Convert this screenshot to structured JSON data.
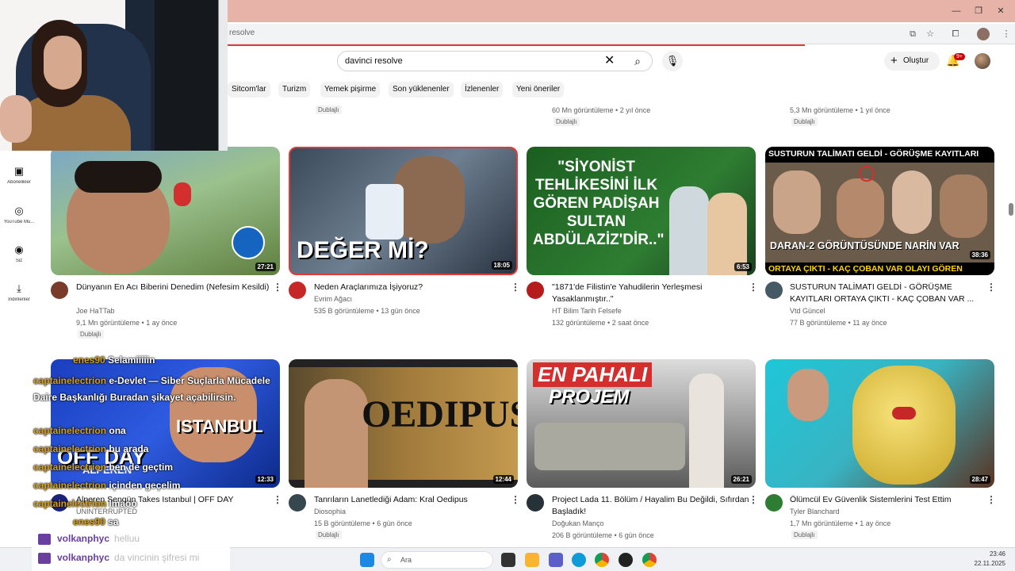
{
  "address": {
    "text": "resolve"
  },
  "search": {
    "query": "davinci resolve"
  },
  "header": {
    "create_label": "Oluştur",
    "notification_badge": "9+"
  },
  "chips": [
    "Sitcom'lar",
    "Turizm",
    "Yemek pişirme",
    "Son yüklenenler",
    "İzlenenler",
    "Yeni öneriler"
  ],
  "top_row": {
    "v1": {
      "dub": "Dublajlı"
    },
    "v2": {
      "meta": "60 Mn görüntüleme • 2 yıl önce",
      "dub": "Dublajlı"
    },
    "v3": {
      "meta": "5,3 Mn görüntüleme • 1 yıl önce",
      "dub": "Dublajlı"
    }
  },
  "sidebar": [
    {
      "label": "Abonelikler",
      "icon": "subscriptions-icon"
    },
    {
      "label": "YouTube Mu...",
      "icon": "youtube-music-icon"
    },
    {
      "label": "Siz",
      "icon": "you-icon"
    },
    {
      "label": "İndirilenler",
      "icon": "downloads-icon"
    }
  ],
  "videos": [
    {
      "thumb_text": "",
      "duration": "27:21",
      "title": "Dünyanın En Acı Biberini Denedim (Nefesim Kesildi)",
      "channel": "Joe HaTTab",
      "meta": "9,1 Mn görüntüleme • 1 ay önce",
      "dub": "Dublajlı",
      "avatar_color": "#7a3b2a"
    },
    {
      "thumb_text": "DEĞER Mİ?",
      "duration": "18:05",
      "title": "Neden Araçlarımıza İşiyoruz?",
      "channel": "Evrim Ağacı",
      "meta": "535 B görüntüleme • 13 gün önce",
      "dub": "",
      "avatar_color": "#c62828"
    },
    {
      "thumb_text": "\"SİYONİST TEHLİKESİNİ İLK GÖREN PADİŞAH SULTAN ABDÜLAZİZ'DİR..\"",
      "duration": "6:53",
      "title": "\"1871'de Filistin'e Yahudilerin Yerleşmesi Yasaklanmıştır..\"",
      "channel": "HT Bilim Tarih Felsefe",
      "meta": "132 görüntüleme • 2 saat önce",
      "dub": "",
      "avatar_color": "#b71c1c"
    },
    {
      "thumb_text": "SUSTURUN TALİMATI GELDİ - GÖRÜŞME KAYITLARI",
      "thumb_text2": "DARAN-2 GÖRÜNTÜSÜNDE NARİN VAR",
      "thumb_text3": "ORTAYA ÇIKTI - KAÇ ÇOBAN VAR OLAYI GÖREN",
      "duration": "38:36",
      "title": "SUSTURUN TALİMATI GELDİ - GÖRÜŞME KAYITLARI ORTAYA ÇIKTI - KAÇ ÇOBAN VAR ...",
      "channel": "Vtd Güncel",
      "meta": "77 B görüntüleme • 11 ay önce",
      "dub": "",
      "avatar_color": "#455a64"
    },
    {
      "thumb_text": "OFF DAY",
      "thumb_text2": "ISTANBUL",
      "thumb_text3": "ALPEREN",
      "duration": "12:33",
      "title": "Alperen Sengün Takes Istanbul | OFF DAY",
      "channel": "UNINTERRUPTED",
      "meta": "",
      "dub": "",
      "avatar_color": "#1a237e"
    },
    {
      "thumb_text": "OEDIPUS",
      "duration": "12:44",
      "title": "Tanrıların Lanetlediği Adam: Kral Oedipus",
      "channel": "Diosophia",
      "meta": "15 B görüntüleme • 6 gün önce",
      "dub": "Dublajlı",
      "avatar_color": "#37474f"
    },
    {
      "thumb_text": "EN PAHALI",
      "thumb_text2": "PROJEM",
      "duration": "26:21",
      "title": "Project Lada 11. Bölüm / Hayalim Bu Değildi, Sıfırdan Başladık!",
      "channel": "Doğukan Manço",
      "meta": "206 B görüntüleme • 6 gün önce",
      "dub": "Dublajlı",
      "avatar_color": "#263238"
    },
    {
      "thumb_text": "",
      "duration": "28:47",
      "title": "Ölümcül Ev Güvenlik Sistemlerini Test Ettim",
      "channel": "Tyler Blanchard",
      "meta": "1,7 Mn görüntüleme • 1 ay önce",
      "dub": "Dublajlı",
      "avatar_color": "#2e7d32"
    }
  ],
  "chat_overlay": [
    {
      "name": "enes90",
      "msg": "Selamiiiiin"
    },
    {
      "name": "captainelectrion",
      "msg": "e-Devlet — Siber Suçlarla Mücadele Daire Başkanlığı Buradan şikayet açabilirsin."
    },
    {
      "name": "captainelectrion",
      "msg": "ona"
    },
    {
      "name": "captainelectrion",
      "msg": "bu arada"
    },
    {
      "name": "captainelectrion",
      "msg": "ben de geçtim"
    },
    {
      "name": "captainelectrion",
      "msg": "içinden geçelim"
    },
    {
      "name": "captainelectrion",
      "msg": "lmaoo"
    },
    {
      "name": "enes90",
      "msg": "sa"
    }
  ],
  "chat_strip": [
    {
      "name": "volkanphyc",
      "msg": "helluu"
    },
    {
      "name": "volkanphyc",
      "msg": "da vincinin şifresi mi"
    }
  ],
  "taskbar": {
    "search_placeholder": "Ara",
    "time": "23:46",
    "date": "22.11.2025"
  },
  "colors": {
    "accent": "#cc0000",
    "brand": "#ff0000",
    "chat_name": "#d4a017",
    "strip_name": "#6a3fa0"
  }
}
